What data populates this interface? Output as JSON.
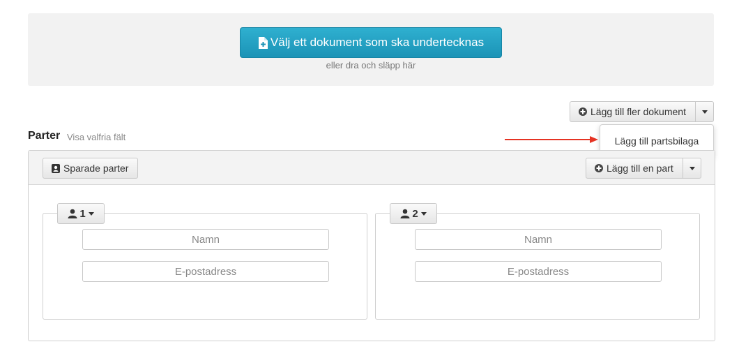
{
  "upload": {
    "button_label": "Välj ett dokument som ska undertecknas",
    "hint": "eller dra och släpp här",
    "icon": "file-plus-icon",
    "color": "#1f9ec2"
  },
  "documents": {
    "add_more_label": "Lägg till fler dokument",
    "menu_items": [
      "Lägg till partsbilaga"
    ]
  },
  "annotation": {
    "arrow_color": "#e53323"
  },
  "parties": {
    "title": "Parter",
    "optional_fields_link": "Visa valfria fält",
    "saved_parties_label": "Sparade parter",
    "add_party_label": "Lägg till en part",
    "cards": [
      {
        "number": "1",
        "name_placeholder": "Namn",
        "email_placeholder": "E-postadress"
      },
      {
        "number": "2",
        "name_placeholder": "Namn",
        "email_placeholder": "E-postadress"
      }
    ]
  }
}
